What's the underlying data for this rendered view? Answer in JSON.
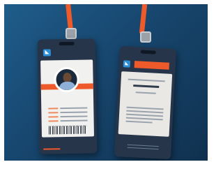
{
  "scene": {
    "background_colors": [
      "#1f5d8a",
      "#10314f"
    ],
    "accent_color": "#ef5a2a",
    "card_color": "#27354a",
    "brand_blue": "#2a8fd6"
  },
  "front_card": {
    "logo_icon": "company-logo-icon",
    "brand_name": "",
    "brand_tagline": "",
    "person_name": "",
    "person_role": ""
  },
  "back_card": {
    "logo_icon": "company-logo-icon",
    "tab_label": "",
    "heading": ""
  }
}
